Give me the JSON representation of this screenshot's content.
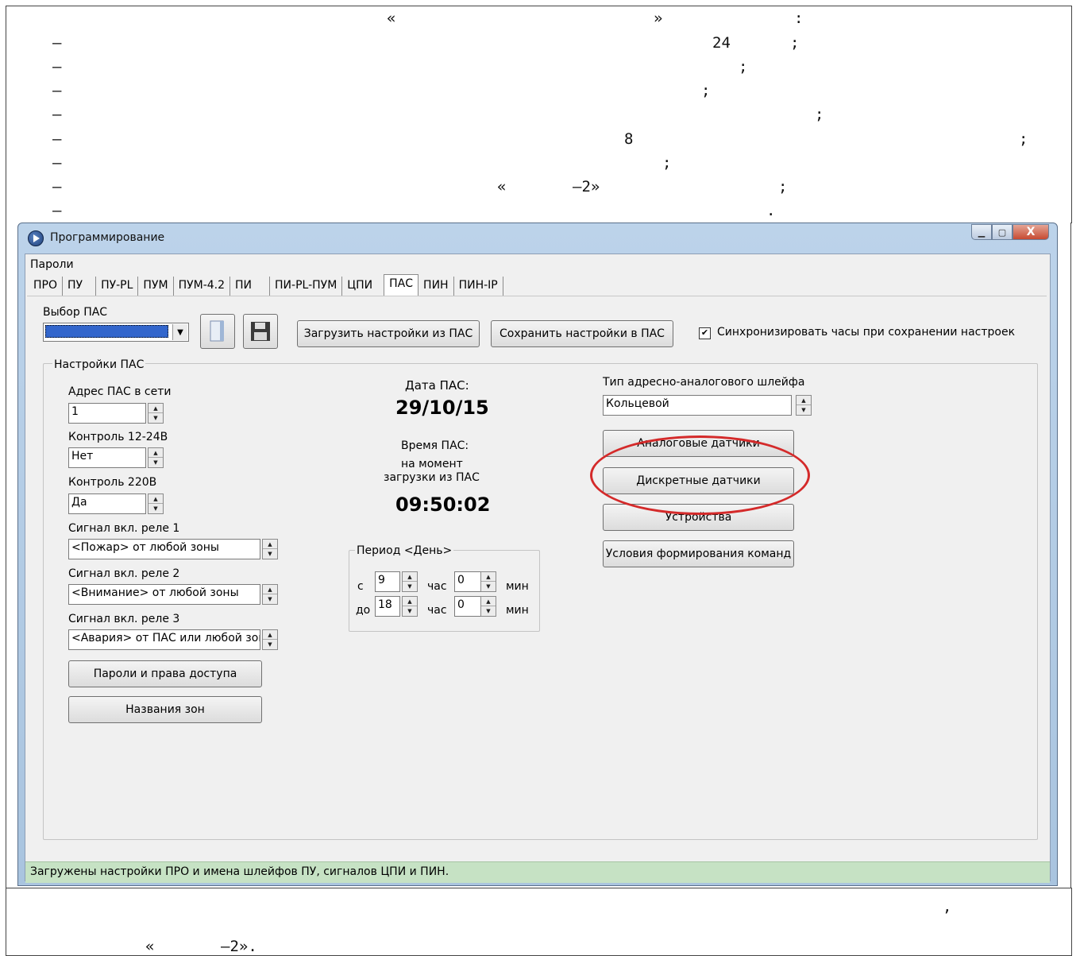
{
  "doc": {
    "line1": {
      "q_open": "«",
      "q_close": "»",
      "colon": ":"
    },
    "line2": {
      "dash": "–",
      "num": "24",
      "semi": ";"
    },
    "line3": {
      "dash": "–",
      "semi": ";"
    },
    "line4": {
      "dash": "–",
      "semi": ";"
    },
    "line5": {
      "dash": "–",
      "semi": ";"
    },
    "line6": {
      "dash": "–",
      "num": "8",
      "semi": ";"
    },
    "line7": {
      "dash": "–",
      "semi": ";"
    },
    "line8": {
      "dash": "–",
      "q_open": "«",
      "q_tail": "–2»",
      "semi": ";"
    },
    "line9": {
      "dash": "–",
      "dot": "."
    },
    "after1": {
      "comma": ","
    },
    "after2": {
      "q_open": "«",
      "q_tail": "–2»."
    }
  },
  "window": {
    "title": "Программирование",
    "minimize": "▁",
    "maximize": "▢",
    "close": "X",
    "menu": "Пароли",
    "tabs": [
      "ПРО",
      "ПУ",
      "ПУ-PL",
      "ПУМ",
      "ПУМ-4.2",
      "ПИ",
      "ПИ-PL-ПУМ",
      "ЦПИ",
      "ПАС",
      "ПИН",
      "ПИН-IP"
    ],
    "active_tab": "ПАС",
    "toolbar": {
      "select_label": "Выбор ПАС",
      "load_button": "Загрузить  настройки из ПАС",
      "save_button": "Сохранить настройки в ПАС",
      "sync_checkbox": "Синхронизировать часы при сохранении настроек",
      "sync_checked": "✔"
    },
    "settings": {
      "group_title": "Настройки ПАС",
      "address_label": "Адрес ПАС в сети",
      "address_value": "1",
      "control1224_label": "Контроль 12-24В",
      "control1224_value": "Нет",
      "control220_label": "Контроль 220В",
      "control220_value": "Да",
      "relay1_label": "Сигнал вкл. реле 1",
      "relay1_value": "<Пожар> от любой зоны",
      "relay2_label": "Сигнал вкл. реле 2",
      "relay2_value": "<Внимание> от любой зоны",
      "relay3_label": "Сигнал вкл. реле 3",
      "relay3_value": "<Авария> от ПАС или любой зоны",
      "passwords_button": "Пароли и права доступа",
      "zones_button": "Названия зон",
      "date_label": "Дата ПАС:",
      "date_value": "29/10/15",
      "time_label1": "Время ПАС:",
      "time_label2": "на момент",
      "time_label3": "загрузки из ПАС",
      "time_value": "09:50:02",
      "period_title": "Период <День>",
      "from_label": "с",
      "to_label": "до",
      "from_hour": "9",
      "from_min": "0",
      "to_hour": "18",
      "to_min": "0",
      "hour_unit": "час",
      "min_unit": "мин",
      "loop_type_label": "Тип адресно-аналогового шлейфа",
      "loop_type_value": "Кольцевой",
      "analog_button": "Аналоговые датчики",
      "discrete_button": "Дискретные датчики",
      "devices_button": "Устройства",
      "commands_button": "Условия формирования команд"
    },
    "status": "Загружены настройки ПРО и имена шлейфов ПУ, сигналов ЦПИ и ПИН."
  },
  "colors": {
    "highlight_oval": "#d42a2a",
    "status_bg": "#c6e2c4",
    "select_highlight": "#3366cc"
  }
}
